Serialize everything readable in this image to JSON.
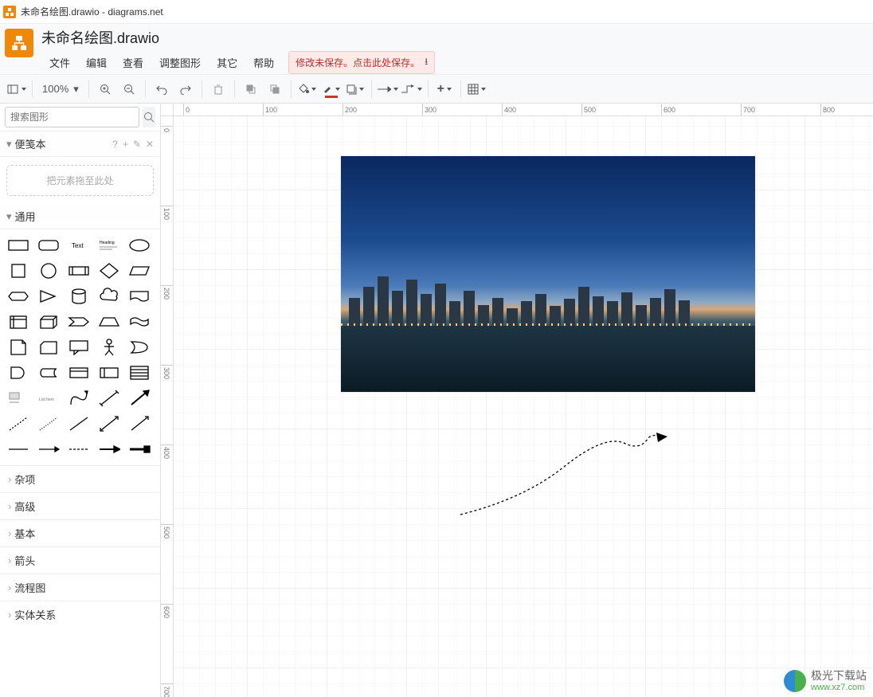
{
  "window": {
    "title": "未命名绘图.drawio - diagrams.net"
  },
  "doc": {
    "title": "未命名绘图.drawio"
  },
  "menubar": {
    "items": [
      {
        "label": "文件"
      },
      {
        "label": "编辑"
      },
      {
        "label": "查看"
      },
      {
        "label": "调整图形"
      },
      {
        "label": "其它"
      },
      {
        "label": "帮助"
      }
    ],
    "save_label": "修改未保存。点击此处保存。"
  },
  "toolbar": {
    "zoom": "100%"
  },
  "sidebar": {
    "search_placeholder": "搜索图形",
    "scratchpad_title": "便笺本",
    "drop_hint": "把元素拖至此处",
    "general_title": "通用",
    "categories": [
      {
        "label": "杂项"
      },
      {
        "label": "高级"
      },
      {
        "label": "基本"
      },
      {
        "label": "箭头"
      },
      {
        "label": "流程图"
      },
      {
        "label": "实体关系"
      }
    ]
  },
  "ruler": {
    "h": [
      "0",
      "100",
      "200",
      "300",
      "400",
      "500",
      "600",
      "700",
      "800"
    ],
    "v": [
      "0",
      "100",
      "200",
      "300",
      "400",
      "500",
      "600",
      "700"
    ]
  },
  "watermark": {
    "name": "极光下载站",
    "url": "www.xz7.com"
  }
}
